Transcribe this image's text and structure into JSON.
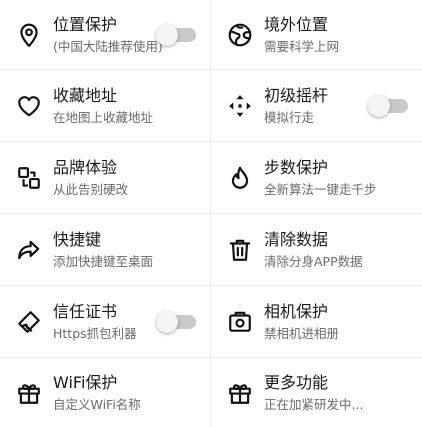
{
  "items": [
    {
      "title": "位置保护",
      "subtitle": "(中国大陆推荐使用)",
      "icon": "location-pin-icon",
      "toggle": false
    },
    {
      "title": "境外位置",
      "subtitle": "需要科学上网",
      "icon": "globe-icon"
    },
    {
      "title": "收藏地址",
      "subtitle": "在地图上收藏地址",
      "icon": "heart-icon"
    },
    {
      "title": "初级摇杆",
      "subtitle": "模拟行走",
      "icon": "move-arrows-icon",
      "toggle": false
    },
    {
      "title": "品牌体验",
      "subtitle": "从此告别硬改",
      "icon": "brand-blocks-icon"
    },
    {
      "title": "步数保护",
      "subtitle": "全新算法一键走千步",
      "icon": "flame-icon"
    },
    {
      "title": "快捷键",
      "subtitle": "添加快捷键至桌面",
      "icon": "share-arrow-icon"
    },
    {
      "title": "清除数据",
      "subtitle": "清除分身APP数据",
      "icon": "trash-icon"
    },
    {
      "title": "信任证书",
      "subtitle": "Https抓包利器",
      "icon": "certificate-tag-icon",
      "toggle": false
    },
    {
      "title": "相机保护",
      "subtitle": "禁相机进相册",
      "icon": "camera-icon"
    },
    {
      "title": "WiFi保护",
      "subtitle": "自定义WiFi名称",
      "icon": "gift-icon"
    },
    {
      "title": "更多功能",
      "subtitle": "正在加紧研发中...",
      "icon": "gift-icon"
    }
  ],
  "colors": {
    "text": "#1a1a1a",
    "subtext": "#6a6a6a",
    "toggle_track": "#c9c9c9",
    "toggle_knob": "#f4f4f4",
    "divider": "#ececec"
  }
}
